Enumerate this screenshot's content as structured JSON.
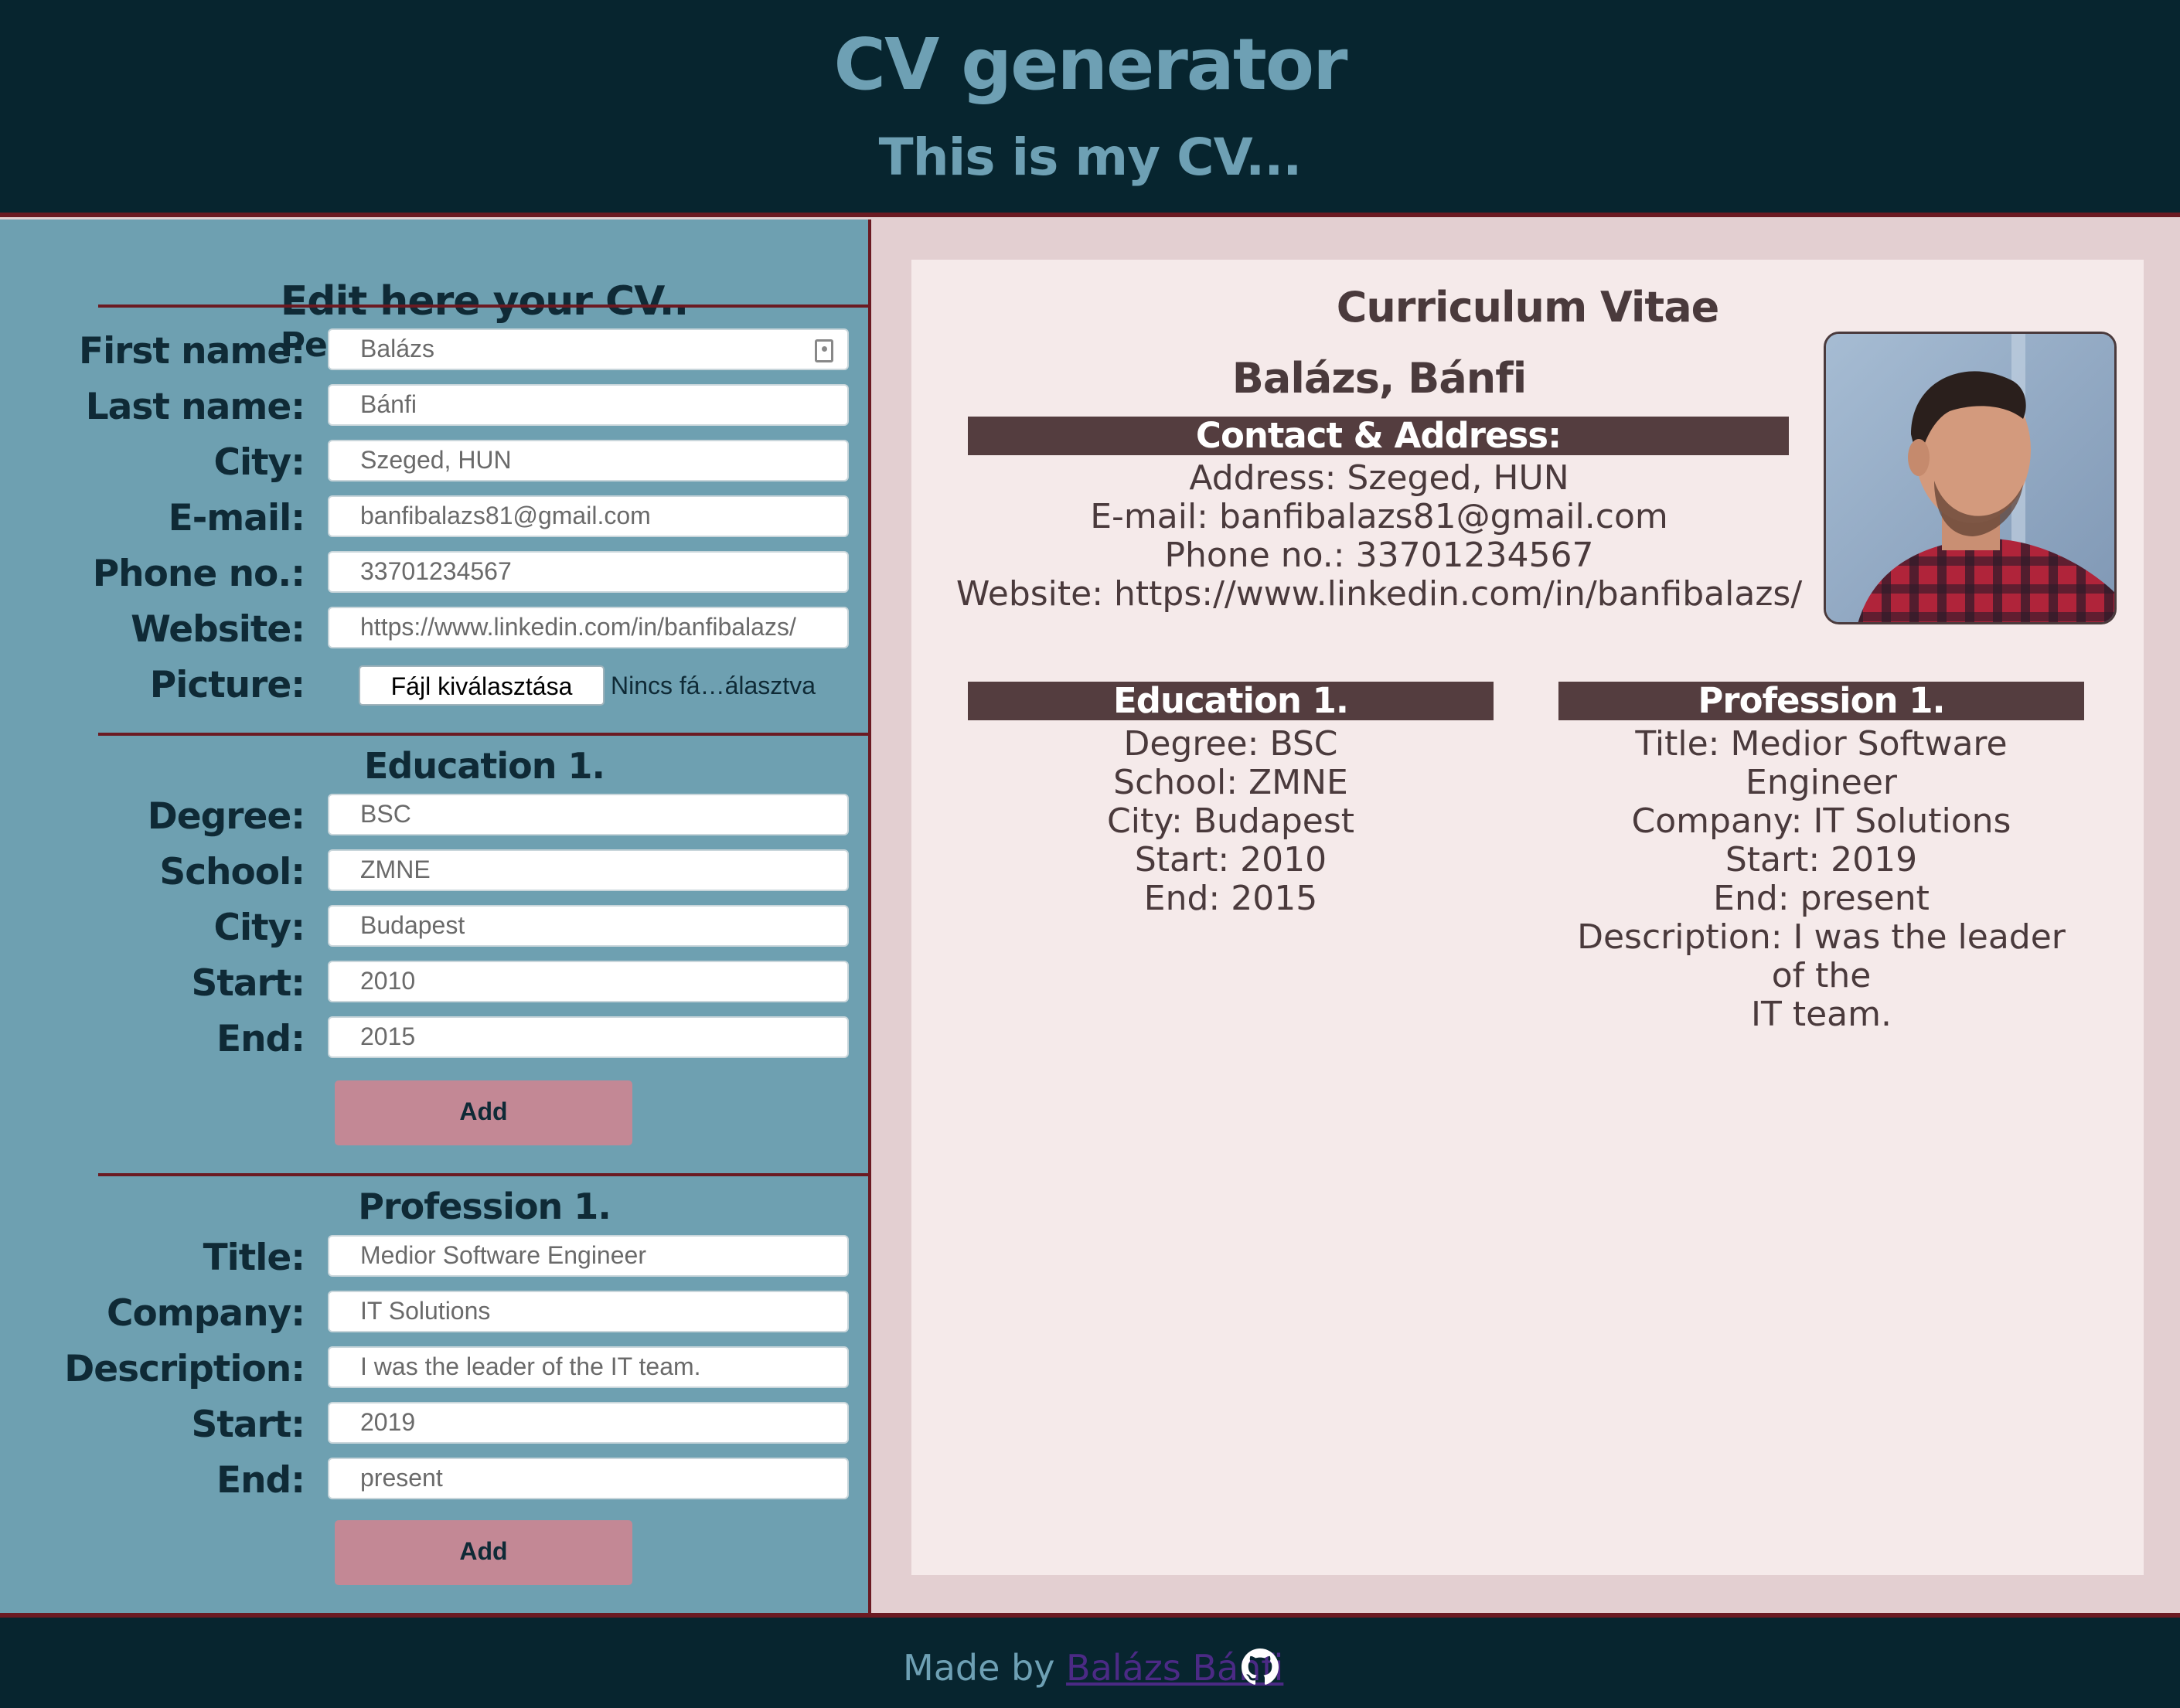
{
  "header": {
    "title": "CV generator",
    "subtitle": "This is my CV..."
  },
  "editor": {
    "title": "Edit here your CV..",
    "personal_heading": "Personal informations",
    "personal": [
      {
        "label": "First name:",
        "value": "Balázs"
      },
      {
        "label": "Last name:",
        "value": "Bánfi"
      },
      {
        "label": "City:",
        "value": "Szeged, HUN"
      },
      {
        "label": "E-mail:",
        "value": "banfibalazs81@gmail.com"
      },
      {
        "label": "Phone no.:",
        "value": "33701234567"
      },
      {
        "label": "Website:",
        "value": "https://www.linkedin.com/in/banfibalazs/"
      }
    ],
    "picture": {
      "label": "Picture:",
      "button": "Fájl kiválasztása",
      "status": "Nincs fá…álasztva"
    },
    "education_heading": "Education 1.",
    "education": [
      {
        "label": "Degree:",
        "value": "BSC"
      },
      {
        "label": "School:",
        "value": "ZMNE"
      },
      {
        "label": "City:",
        "value": "Budapest"
      },
      {
        "label": "Start:",
        "value": "2010"
      },
      {
        "label": "End:",
        "value": "2015"
      }
    ],
    "education_add": "Add",
    "profession_heading": "Profession 1.",
    "profession": [
      {
        "label": "Title:",
        "value": "Medior Software Engineer"
      },
      {
        "label": "Company:",
        "value": "IT Solutions"
      },
      {
        "label": "Description:",
        "value": "I was the leader of the IT team."
      },
      {
        "label": "Start:",
        "value": "2019"
      },
      {
        "label": "End:",
        "value": "present"
      }
    ],
    "profession_add": "Add"
  },
  "cv": {
    "title": "Curriculum Vitae",
    "name": "Balázs, Bánfi",
    "contact_heading": "Contact & Address:",
    "contact": [
      "Address: Szeged, HUN",
      "E-mail: banfibalazs81@gmail.com",
      "Phone no.: 33701234567",
      "Website: https://www.linkedin.com/in/banfibalazs/"
    ],
    "education_heading": "Education 1.",
    "education": [
      "Degree: BSC",
      "School: ZMNE",
      "City: Budapest",
      "Start: 2010",
      "End: 2015"
    ],
    "profession_heading": "Profession 1.",
    "profession": [
      "Title: Medior Software Engineer",
      "Company: IT Solutions",
      "Start: 2019",
      "End: present",
      "Description: I was the leader of the",
      "IT team."
    ]
  },
  "footer": {
    "made_by": "Made by",
    "author": "Balázs Bánfi",
    "icon": "github-icon"
  },
  "colors": {
    "header_bg": "#07252f",
    "accent_text": "#6ea0b4",
    "editor_bg": "#6ea0b1",
    "border": "#6b1a22",
    "add_button": "#c38895",
    "cv_bar": "#543d3f",
    "cv_paper": "#f5eaea"
  }
}
